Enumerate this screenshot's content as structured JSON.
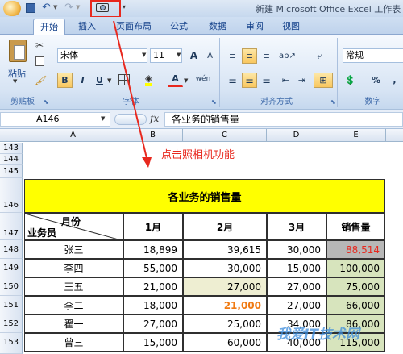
{
  "title_bar": {
    "title": "新建 Microsoft Office Excel 工作表 -"
  },
  "tabs": [
    "开始",
    "插入",
    "页面布局",
    "公式",
    "数据",
    "审阅",
    "视图"
  ],
  "clipboard": {
    "paste_label": "粘贴",
    "group_label": "剪贴板"
  },
  "font_group": {
    "font_name": "宋体",
    "font_size": "11",
    "bold": "B",
    "italic": "I",
    "underline": "U",
    "grow": "A",
    "shrink": "A",
    "phonetic": "wén",
    "group_label": "字体",
    "font_color_glyph": "A"
  },
  "align_group": {
    "group_label": "对齐方式"
  },
  "number_group": {
    "format": "常规",
    "percent": "%",
    "comma": ",",
    "group_label": "数字"
  },
  "formula_bar": {
    "name_box": "A146",
    "fx": "fx",
    "content": "各业务的销售量"
  },
  "columns": [
    "A",
    "B",
    "C",
    "D",
    "E"
  ],
  "row_numbers": [
    "143",
    "144",
    "145",
    "146",
    "147",
    "148",
    "149",
    "150",
    "151",
    "152",
    "153"
  ],
  "annotation": {
    "text": "点击照相机功能",
    "color": "#e8281e"
  },
  "table": {
    "title": "各业务的销售量",
    "corner_top": "月份",
    "corner_bottom": "业务员",
    "headers": [
      "1月",
      "2月",
      "3月",
      "销售量"
    ],
    "rows": [
      {
        "name": "张三",
        "m1": "18,899",
        "m2": "39,615",
        "m3": "30,000",
        "total": "88,514"
      },
      {
        "name": "李四",
        "m1": "55,000",
        "m2": "30,000",
        "m3": "15,000",
        "total": "100,000"
      },
      {
        "name": "王五",
        "m1": "21,000",
        "m2": "27,000",
        "m3": "27,000",
        "total": "75,000"
      },
      {
        "name": "李二",
        "m1": "18,000",
        "m2": "21,000",
        "m3": "27,000",
        "total": "66,000"
      },
      {
        "name": "翟一",
        "m1": "27,000",
        "m2": "25,000",
        "m3": "34,000",
        "total": "86,000"
      },
      {
        "name": "曾三",
        "m1": "15,000",
        "m2": "60,000",
        "m3": "40,000",
        "total": "115,000"
      }
    ]
  },
  "colors": {
    "title_fill": "#ffff00",
    "highlight": "#e8281e",
    "orange": "#f07a12",
    "total_fill": "#d7e4bd",
    "selected_fill": "#b7b7b7"
  },
  "watermark": "我爱IT技术网"
}
